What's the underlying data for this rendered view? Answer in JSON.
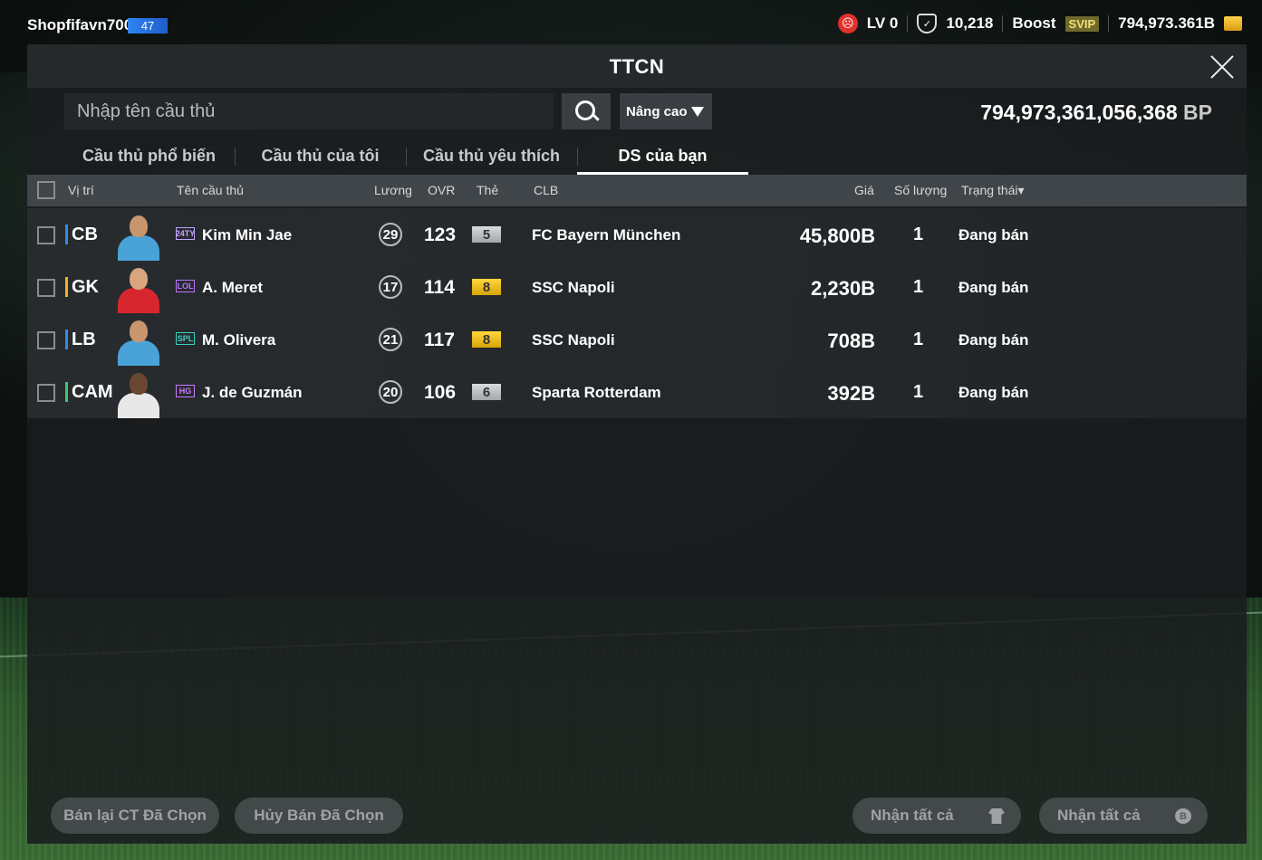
{
  "hud": {
    "username": "Shopfifavn700",
    "level_badge": "47",
    "lv_label": "LV 0",
    "points": "10,218",
    "boost_label": "Boost",
    "svip_label": "SVIP",
    "bp_balance": "794,973.361B"
  },
  "modal": {
    "title": "TTCN",
    "search_placeholder": "Nhập tên cầu thủ",
    "advanced_label": "Nâng cao",
    "balance_value": "794,973,361,056,368",
    "balance_unit": "BP"
  },
  "tabs": [
    {
      "label": "Cầu thủ phổ biến",
      "active": false
    },
    {
      "label": "Cầu thủ của tôi",
      "active": false
    },
    {
      "label": "Cầu thủ yêu thích",
      "active": false
    },
    {
      "label": "DS của bạn",
      "active": true
    }
  ],
  "table": {
    "headers": {
      "position": "Vị trí",
      "name": "Tên cầu thủ",
      "salary": "Lương",
      "ovr": "OVR",
      "card": "Thẻ",
      "club": "CLB",
      "price": "Giá",
      "quantity": "Số lượng",
      "status": "Trạng thái▾"
    },
    "rows": [
      {
        "position": "CB",
        "season": "24TY",
        "name": "Kim Min Jae",
        "salary": "29",
        "ovr": "123",
        "card": "5",
        "club": "FC Bayern München",
        "price": "45,800B",
        "quantity": "1",
        "status": "Đang bán"
      },
      {
        "position": "GK",
        "season": "LOL",
        "name": "A. Meret",
        "salary": "17",
        "ovr": "114",
        "card": "8",
        "club": "SSC Napoli",
        "price": "2,230B",
        "quantity": "1",
        "status": "Đang bán"
      },
      {
        "position": "LB",
        "season": "SPL",
        "name": "M. Olivera",
        "salary": "21",
        "ovr": "117",
        "card": "8",
        "club": "SSC Napoli",
        "price": "708B",
        "quantity": "1",
        "status": "Đang bán"
      },
      {
        "position": "CAM",
        "season": "HG",
        "name": "J. de Guzmán",
        "salary": "20",
        "ovr": "106",
        "card": "6",
        "club": "Sparta Rotterdam",
        "price": "392B",
        "quantity": "1",
        "status": "Đang bán"
      }
    ]
  },
  "footer": {
    "resell_selected": "Bán lại CT Đã Chọn",
    "cancel_selected": "Hủy Bán Đã Chọn",
    "receive_all_players": "Nhận tất cả",
    "receive_all_bp": "Nhận tất cả"
  },
  "colors": {
    "position_defender": "#2c8cf0",
    "position_goalkeeper": "#f2b21d",
    "season_24ty": "#c3a2ff",
    "season_lol": "#b873ff",
    "season_spl": "#3ad1c1",
    "season_hg": "#c77bff"
  }
}
